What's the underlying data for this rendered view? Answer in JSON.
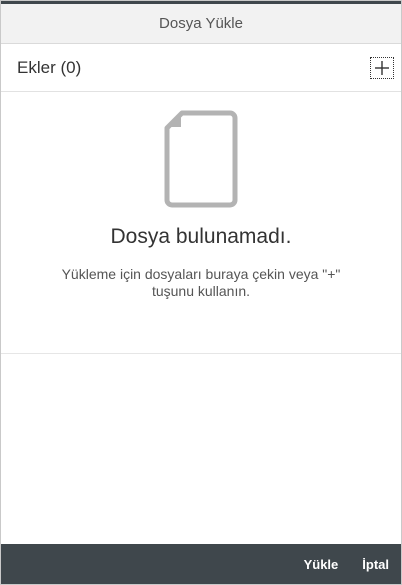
{
  "dialog": {
    "title": "Dosya Yükle"
  },
  "attachments": {
    "heading": "Ekler (0)",
    "add_icon": "plus-icon"
  },
  "empty_state": {
    "icon": "document-icon",
    "title": "Dosya bulunamadı.",
    "description": "Yükleme için dosyaları buraya çekin veya \"+\" tuşunu kullanın."
  },
  "footer": {
    "upload_label": "Yükle",
    "cancel_label": "İptal"
  },
  "colors": {
    "footer_bg": "#3f474c",
    "header_bg": "#f2f2f2",
    "icon_gray": "#b3b3b3"
  }
}
